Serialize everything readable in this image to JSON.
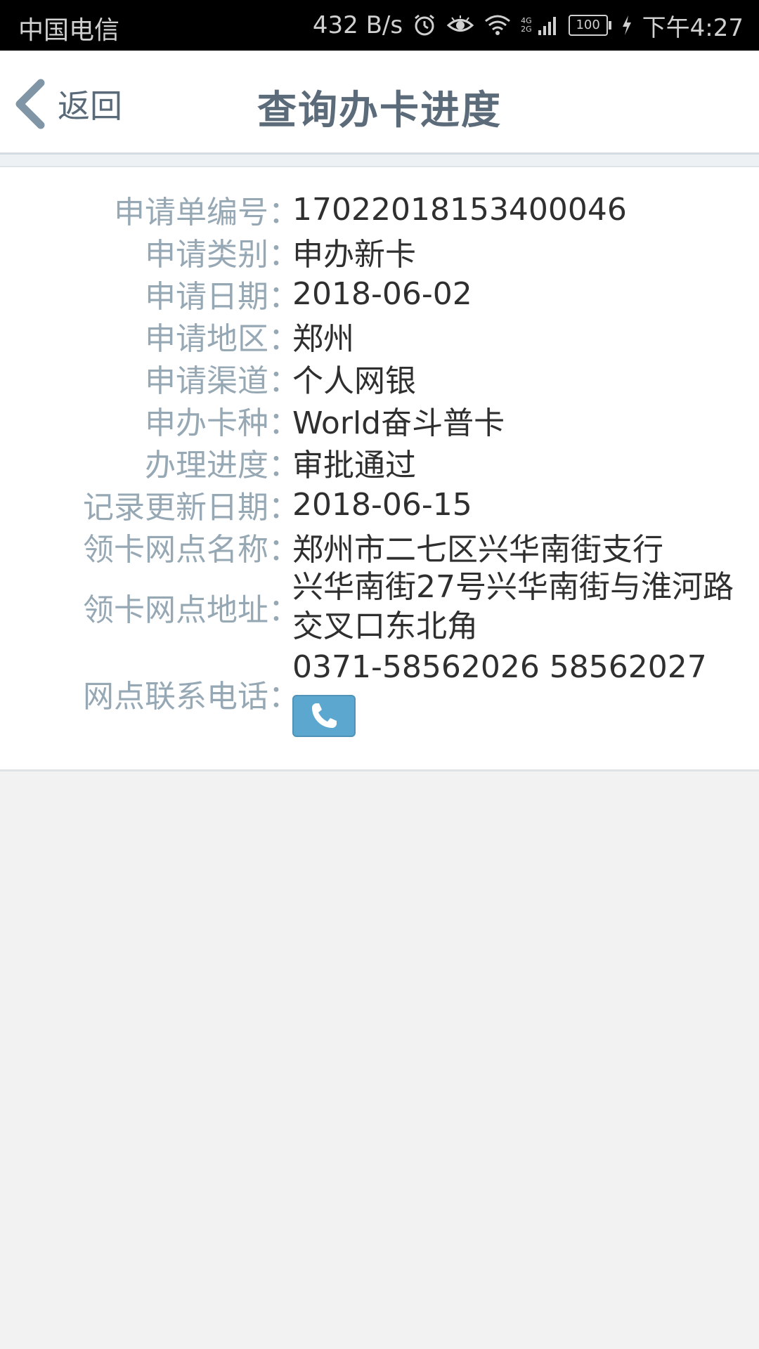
{
  "status_bar": {
    "carrier": "中国电信",
    "net_speed": "432 B/s",
    "network_type_top": "4G",
    "network_type_bottom": "2G",
    "battery": "100",
    "time": "下午4:27",
    "icons": [
      "alarm-icon",
      "eye-icon",
      "wifi-icon",
      "signal-icon",
      "battery-icon",
      "charging-icon"
    ]
  },
  "header": {
    "back_label": "返回",
    "title": "查询办卡进度"
  },
  "details": [
    {
      "label": "申请单编号",
      "value": "17022018153400046"
    },
    {
      "label": "申请类别",
      "value": "申办新卡"
    },
    {
      "label": "申请日期",
      "value": "2018-06-02"
    },
    {
      "label": "申请地区",
      "value": "郑州"
    },
    {
      "label": "申请渠道",
      "value": "个人网银"
    },
    {
      "label": "申办卡种",
      "value": "World奋斗普卡"
    },
    {
      "label": "办理进度",
      "value": "审批通过"
    },
    {
      "label": "记录更新日期",
      "value": "2018-06-15"
    },
    {
      "label": "领卡网点名称",
      "value": "郑州市二七区兴华南街支行"
    },
    {
      "label": "领卡网点地址",
      "value": "兴华南街27号兴华南街与淮河路交叉口东北角"
    },
    {
      "label": "网点联系电话",
      "value": "0371-58562026 58562027"
    }
  ],
  "colon": "：",
  "colors": {
    "label": "#97a8b5",
    "value": "#2f2f2f",
    "title": "#5b6b79",
    "phone_button": "#5ca7cf"
  }
}
